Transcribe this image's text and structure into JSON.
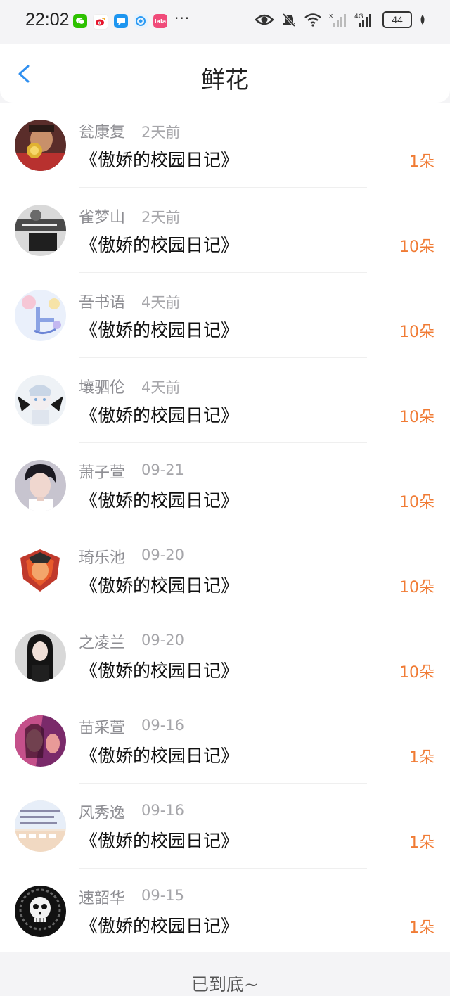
{
  "status_bar": {
    "time": "22:02",
    "apps": [
      {
        "name": "wechat-icon",
        "color": "#2dc100"
      },
      {
        "name": "weibo-icon",
        "color": "#ffffff"
      },
      {
        "name": "message-icon",
        "color": "#1e96f0"
      },
      {
        "name": "browser-icon",
        "color": "#2b9af3"
      },
      {
        "name": "lofter-icon",
        "color": "#f04b7a"
      }
    ],
    "more": "···",
    "network": "4G",
    "battery": "44"
  },
  "header": {
    "title": "鲜花",
    "back_icon": "chevron-left-icon",
    "accent_color": "#2f8ff0"
  },
  "items": [
    {
      "name": "瓮康复",
      "time": "2天前",
      "book": "《傲娇的校园日记》",
      "count": "1朵"
    },
    {
      "name": "雀梦山",
      "time": "2天前",
      "book": "《傲娇的校园日记》",
      "count": "10朵"
    },
    {
      "name": "吾书语",
      "time": "4天前",
      "book": "《傲娇的校园日记》",
      "count": "10朵"
    },
    {
      "name": "壤驷伦",
      "time": "4天前",
      "book": "《傲娇的校园日记》",
      "count": "10朵"
    },
    {
      "name": "萧子萱",
      "time": "09-21",
      "book": "《傲娇的校园日记》",
      "count": "10朵"
    },
    {
      "name": "琦乐池",
      "time": "09-20",
      "book": "《傲娇的校园日记》",
      "count": "10朵"
    },
    {
      "name": "之凌兰",
      "time": "09-20",
      "book": "《傲娇的校园日记》",
      "count": "10朵"
    },
    {
      "name": "苗采萱",
      "time": "09-16",
      "book": "《傲娇的校园日记》",
      "count": "1朵"
    },
    {
      "name": "风秀逸",
      "time": "09-16",
      "book": "《傲娇的校园日记》",
      "count": "1朵"
    },
    {
      "name": "速韶华",
      "time": "09-15",
      "book": "《傲娇的校园日记》",
      "count": "1朵"
    }
  ],
  "footer": {
    "end_text": "已到底~"
  }
}
